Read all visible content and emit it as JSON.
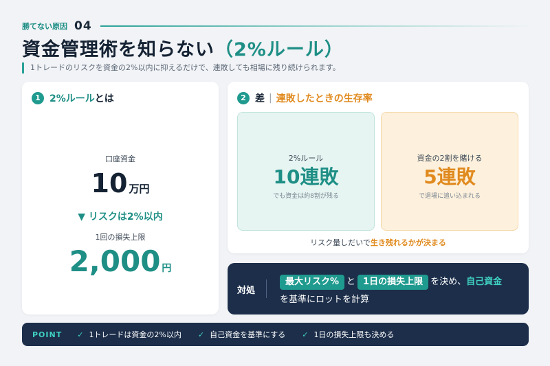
{
  "header": {
    "eyebrow": "勝てない原因",
    "number": "04",
    "title_main": "資金管理術を知らない",
    "title_accent": "（2%ルール）",
    "subtitle": "1トレードのリスクを資金の2%以内に抑えるだけで、連敗しても相場に残り続けられます。"
  },
  "left_card": {
    "badge": "1",
    "title_accent": "2%ルール",
    "title_rest": "とは",
    "capital_label": "口座資金",
    "capital_value": "10",
    "capital_unit": "万円",
    "risk_line": "▼ リスクは2%以内",
    "limit_label": "1回の損失上限",
    "limit_value": "2,000",
    "limit_unit": "円"
  },
  "right_card": {
    "badge": "2",
    "title_dark": "差",
    "separator": "|",
    "title_orange": "連敗したときの生存率",
    "box_green": {
      "label": "2%ルール",
      "value": "10連敗",
      "note": "でも資金は約8割が残る"
    },
    "box_orange": {
      "label": "資金の2割を賭ける",
      "value": "5連敗",
      "note": "で退場に追い込まれる"
    },
    "caption_prefix": "リスク量しだいで",
    "caption_highlight": "生き残れるかが決まる"
  },
  "action": {
    "label": "対処",
    "chip1": "最大リスク%",
    "connector1": "と",
    "chip2": "1日の損失上限",
    "connector2": "を決め、",
    "accent": "自己資金",
    "line2": "を基準にロットを計算"
  },
  "point_bar": {
    "label": "POINT",
    "check": "✓",
    "items": [
      "1トレードは資金の2%以内",
      "自己資金を基準にする",
      "1日の損失上限も決める"
    ]
  },
  "colors": {
    "teal": "#1f8f86",
    "orange": "#e08a1e",
    "navy": "#1c2e4a"
  }
}
